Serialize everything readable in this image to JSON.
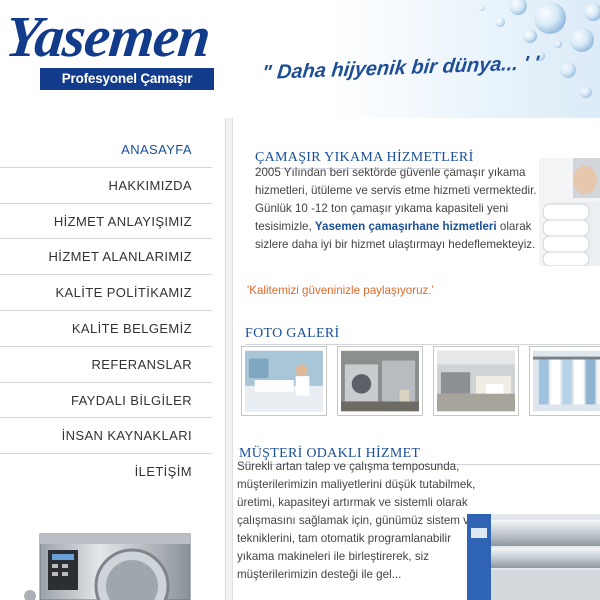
{
  "header": {
    "logo_word": "Yasemen",
    "logo_tagline": "Profesyonel Çamaşır Yıkama",
    "slogan": "\" Daha hijyenik bir dünya... ' '"
  },
  "nav": {
    "items": [
      {
        "label": "ANASAYFA",
        "active": true
      },
      {
        "label": "HAKKIMIZDA"
      },
      {
        "label": "HİZMET ANLAYIŞIMIZ"
      },
      {
        "label": "HİZMET ALANLARIMIZ"
      },
      {
        "label": "KALİTE POLİTİKAMIZ"
      },
      {
        "label": "KALİTE BELGEMİZ"
      },
      {
        "label": "REFERANSLAR"
      },
      {
        "label": "FAYDALI BİLGİLER"
      },
      {
        "label": "İNSAN KAYNAKLARI"
      },
      {
        "label": "İLETİŞİM"
      }
    ]
  },
  "services": {
    "title": "ÇAMAŞIR YIKAMA HİZMETLERİ",
    "para_before": "2005 Yılından beri sektörde güvenle çamaşır yıkama hizmetleri, ütüleme ve servis etme hizmeti vermektedir. Günlük 10 -12 ton çamaşır yıkama kapasiteli yeni tesisimizle, ",
    "para_bold": "Yasemen çamaşırhane hizmetleri",
    "para_after": " olarak sizlere daha iyi bir hizmet ulaştırmayı hedeflemekteyiz.",
    "quote": "'Kalitemizi güveninizle paylaşıyoruz.'"
  },
  "gallery": {
    "title": "FOTO GALERİ",
    "photos": [
      "laundry-folding-photo",
      "washing-machines-photo",
      "industrial-laundry-hall-photo",
      "garment-rack-photo"
    ]
  },
  "customer": {
    "title": "MÜŞTERİ ODAKLI HİZMET",
    "para": "Sürekli artan talep ve çalışma temposunda, müşterilerimizin maliyetlerini düşük tutabilmek, üretimi, kapasiteyi artırmak ve sistemli olarak çalışmasını sağlamak için, günümüz sistem ve tekniklerini, tam otomatik programlanabilir yıkama makineleri ile birleştirerek, siz müşterilerimizin desteği ile gel..."
  },
  "colors": {
    "brand_blue": "#123b8c",
    "link_blue": "#1a4f9b",
    "quote_orange": "#e06a2c"
  }
}
